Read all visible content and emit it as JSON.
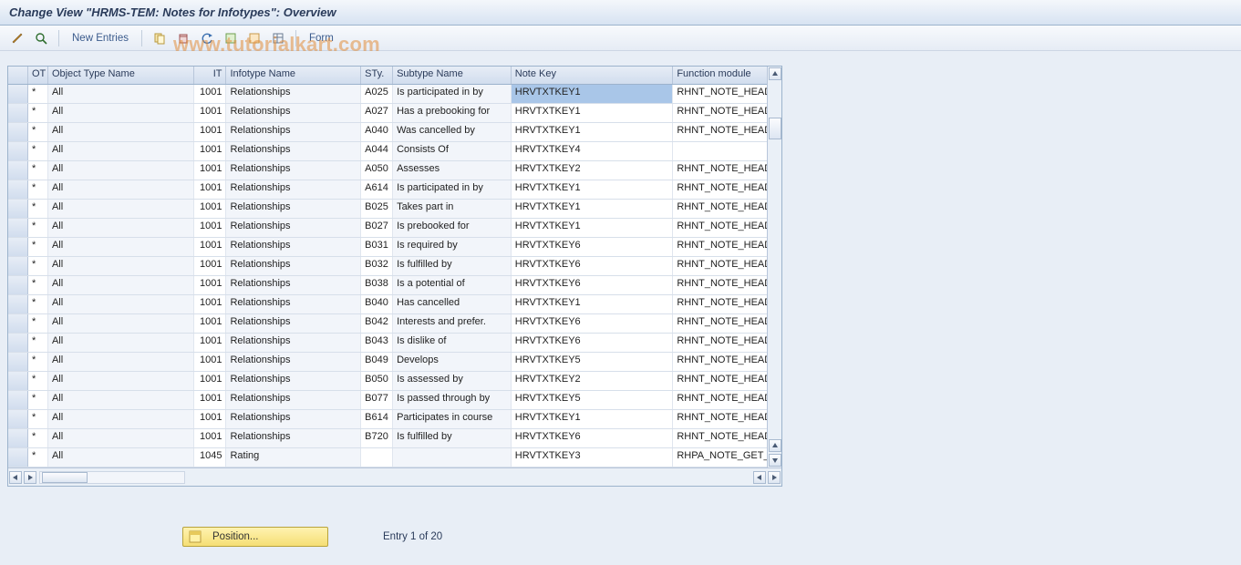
{
  "title": "Change View \"HRMS-TEM: Notes for Infotypes\": Overview",
  "watermark": "www.tutorialkart.com",
  "toolbar": {
    "new_entries": "New Entries",
    "form": "Form"
  },
  "columns": {
    "ot": "OT",
    "otn": "Object Type Name",
    "it": "IT",
    "itn": "Infotype Name",
    "sty": "STy.",
    "styn": "Subtype Name",
    "nk": "Note Key",
    "fm": "Function module"
  },
  "rows": [
    {
      "ot": "*",
      "otn": "All",
      "it": "1001",
      "itn": "Relationships",
      "sty": "A025",
      "styn": "Is participated in by",
      "nk": "HRVTXTKEY1",
      "fm": "RHNT_NOTE_HEADER_I",
      "sel": true
    },
    {
      "ot": "*",
      "otn": "All",
      "it": "1001",
      "itn": "Relationships",
      "sty": "A027",
      "styn": "Has a prebooking for",
      "nk": "HRVTXTKEY1",
      "fm": "RHNT_NOTE_HEADER_I"
    },
    {
      "ot": "*",
      "otn": "All",
      "it": "1001",
      "itn": "Relationships",
      "sty": "A040",
      "styn": "Was cancelled by",
      "nk": "HRVTXTKEY1",
      "fm": "RHNT_NOTE_HEADER_I"
    },
    {
      "ot": "*",
      "otn": "All",
      "it": "1001",
      "itn": "Relationships",
      "sty": "A044",
      "styn": "Consists Of",
      "nk": "HRVTXTKEY4",
      "fm": ""
    },
    {
      "ot": "*",
      "otn": "All",
      "it": "1001",
      "itn": "Relationships",
      "sty": "A050",
      "styn": "Assesses",
      "nk": "HRVTXTKEY2",
      "fm": "RHNT_NOTE_HEADER_I"
    },
    {
      "ot": "*",
      "otn": "All",
      "it": "1001",
      "itn": "Relationships",
      "sty": "A614",
      "styn": "Is participated in by",
      "nk": "HRVTXTKEY1",
      "fm": "RHNT_NOTE_HEADER_I"
    },
    {
      "ot": "*",
      "otn": "All",
      "it": "1001",
      "itn": "Relationships",
      "sty": "B025",
      "styn": "Takes part in",
      "nk": "HRVTXTKEY1",
      "fm": "RHNT_NOTE_HEADER_I"
    },
    {
      "ot": "*",
      "otn": "All",
      "it": "1001",
      "itn": "Relationships",
      "sty": "B027",
      "styn": "Is prebooked for",
      "nk": "HRVTXTKEY1",
      "fm": "RHNT_NOTE_HEADER_I"
    },
    {
      "ot": "*",
      "otn": "All",
      "it": "1001",
      "itn": "Relationships",
      "sty": "B031",
      "styn": "Is required by",
      "nk": "HRVTXTKEY6",
      "fm": "RHNT_NOTE_HEADER_I"
    },
    {
      "ot": "*",
      "otn": "All",
      "it": "1001",
      "itn": "Relationships",
      "sty": "B032",
      "styn": "Is fulfilled by",
      "nk": "HRVTXTKEY6",
      "fm": "RHNT_NOTE_HEADER_I"
    },
    {
      "ot": "*",
      "otn": "All",
      "it": "1001",
      "itn": "Relationships",
      "sty": "B038",
      "styn": "Is a potential of",
      "nk": "HRVTXTKEY6",
      "fm": "RHNT_NOTE_HEADER_I"
    },
    {
      "ot": "*",
      "otn": "All",
      "it": "1001",
      "itn": "Relationships",
      "sty": "B040",
      "styn": "Has cancelled",
      "nk": "HRVTXTKEY1",
      "fm": "RHNT_NOTE_HEADER_I"
    },
    {
      "ot": "*",
      "otn": "All",
      "it": "1001",
      "itn": "Relationships",
      "sty": "B042",
      "styn": "Interests and prefer.",
      "nk": "HRVTXTKEY6",
      "fm": "RHNT_NOTE_HEADER_I"
    },
    {
      "ot": "*",
      "otn": "All",
      "it": "1001",
      "itn": "Relationships",
      "sty": "B043",
      "styn": "Is dislike of",
      "nk": "HRVTXTKEY6",
      "fm": "RHNT_NOTE_HEADER_I"
    },
    {
      "ot": "*",
      "otn": "All",
      "it": "1001",
      "itn": "Relationships",
      "sty": "B049",
      "styn": "Develops",
      "nk": "HRVTXTKEY5",
      "fm": "RHNT_NOTE_HEADER_I"
    },
    {
      "ot": "*",
      "otn": "All",
      "it": "1001",
      "itn": "Relationships",
      "sty": "B050",
      "styn": "Is assessed by",
      "nk": "HRVTXTKEY2",
      "fm": "RHNT_NOTE_HEADER_I"
    },
    {
      "ot": "*",
      "otn": "All",
      "it": "1001",
      "itn": "Relationships",
      "sty": "B077",
      "styn": "Is passed through by",
      "nk": "HRVTXTKEY5",
      "fm": "RHNT_NOTE_HEADER_I"
    },
    {
      "ot": "*",
      "otn": "All",
      "it": "1001",
      "itn": "Relationships",
      "sty": "B614",
      "styn": "Participates in course",
      "nk": "HRVTXTKEY1",
      "fm": "RHNT_NOTE_HEADER_I"
    },
    {
      "ot": "*",
      "otn": "All",
      "it": "1001",
      "itn": "Relationships",
      "sty": "B720",
      "styn": "Is fulfilled by",
      "nk": "HRVTXTKEY6",
      "fm": "RHNT_NOTE_HEADER_I"
    },
    {
      "ot": "*",
      "otn": "All",
      "it": "1045",
      "itn": "Rating",
      "sty": "",
      "styn": "",
      "nk": "HRVTXTKEY3",
      "fm": "RHPA_NOTE_GET_HEAI"
    }
  ],
  "footer": {
    "position_label": "Position...",
    "entry_text": "Entry 1 of 20"
  }
}
